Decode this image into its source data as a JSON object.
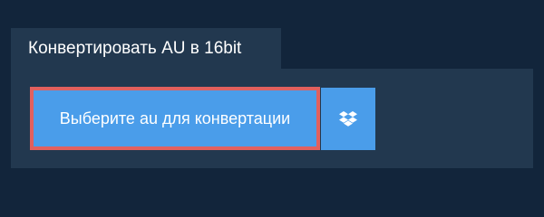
{
  "tab": {
    "label": "Конвертировать AU в 16bit"
  },
  "upload": {
    "label": "Выберите au для конвертации"
  },
  "dropbox": {
    "icon": "dropbox-icon"
  },
  "colors": {
    "background": "#12253b",
    "panel": "#22384f",
    "button": "#4a9dea",
    "highlight_border": "#e1605e",
    "text": "#ffffff"
  }
}
